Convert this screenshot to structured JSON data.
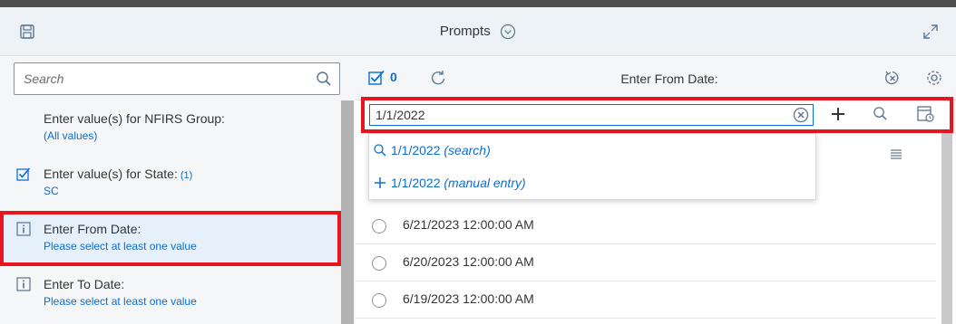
{
  "header": {
    "title": "Prompts"
  },
  "search": {
    "placeholder": "Search"
  },
  "prompt_list": [
    {
      "title": "Enter value(s) for NFIRS Group:",
      "count": "",
      "subtitle": "(All values)",
      "icon": "none"
    },
    {
      "title": "Enter value(s) for State:",
      "count": "(1)",
      "subtitle": "SC",
      "icon": "checkbox-icon"
    },
    {
      "title": "Enter From Date:",
      "count": "",
      "subtitle": "Please select at least one value",
      "icon": "info-icon"
    },
    {
      "title": "Enter To Date:",
      "count": "",
      "subtitle": "Please select at least one value",
      "icon": "info-icon"
    }
  ],
  "right_panel": {
    "selected_count": "0",
    "title": "Enter From Date:",
    "input_value": "1/1/2022"
  },
  "suggestions": [
    {
      "text": "1/1/2022",
      "suffix": "(search)",
      "icon": "search-icon"
    },
    {
      "text": "1/1/2022",
      "suffix": "(manual entry)",
      "icon": "plus-icon"
    }
  ],
  "values": [
    "6/21/2023 12:00:00 AM",
    "6/20/2023 12:00:00 AM",
    "6/19/2023 12:00:00 AM"
  ],
  "colors": {
    "accent": "#0a6ed1",
    "highlight": "#e8151e",
    "header_bg": "#edf2f7"
  }
}
